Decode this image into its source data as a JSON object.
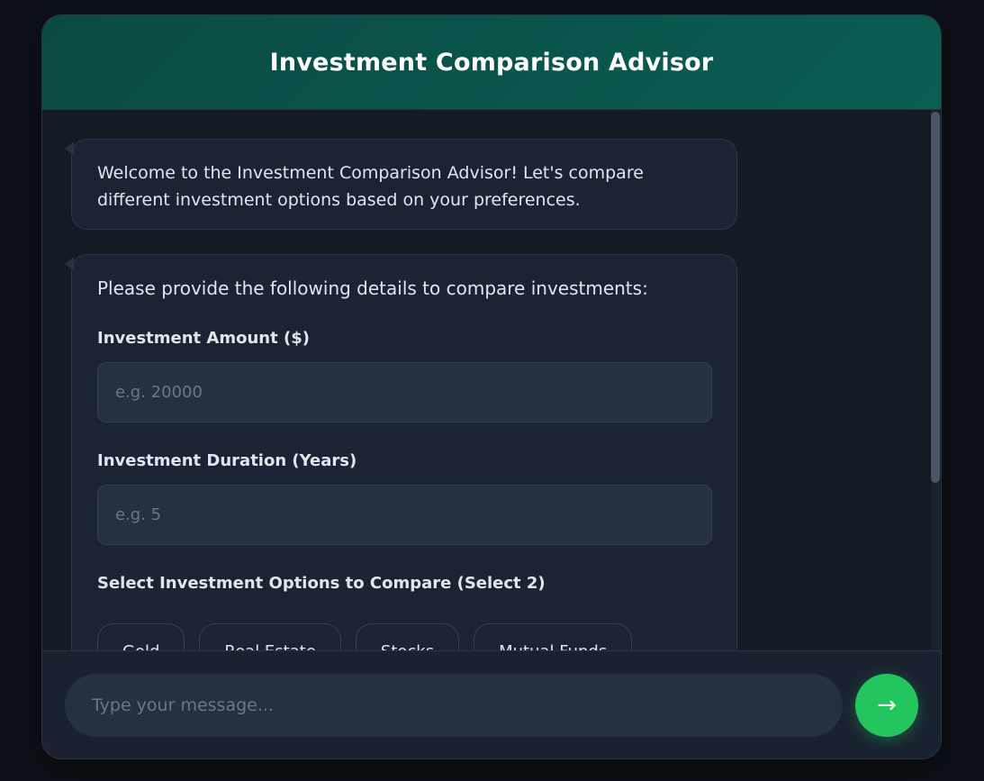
{
  "header": {
    "title": "Investment Comparison Advisor"
  },
  "messages": {
    "welcome": "Welcome to the Investment Comparison Advisor! Let's compare different investment options based on your preferences.",
    "form": {
      "intro": "Please provide the following details to compare investments:",
      "amount_label": "Investment Amount ($)",
      "amount_placeholder": "e.g. 20000",
      "duration_label": "Investment Duration (Years)",
      "duration_placeholder": "e.g. 5",
      "options_label": "Select Investment Options to Compare (Select 2)",
      "options": [
        "Gold",
        "Real Estate",
        "Stocks",
        "Mutual Funds"
      ]
    }
  },
  "composer": {
    "placeholder": "Type your message...",
    "send_icon": "→"
  },
  "colors": {
    "header_start": "#0b4a43",
    "header_end": "#0a5e52",
    "send_button": "#22c55e",
    "background": "#0d1117"
  },
  "icons": {
    "send": "arrow-right-icon"
  }
}
